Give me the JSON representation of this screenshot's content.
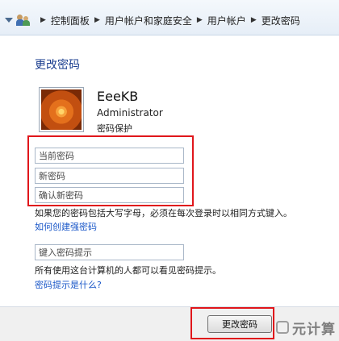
{
  "breadcrumb": {
    "items": [
      "控制面板",
      "用户帐户和家庭安全",
      "用户帐户",
      "更改密码"
    ],
    "icon": "users-icon"
  },
  "page": {
    "title": "更改密码"
  },
  "user": {
    "name": "EeeKB",
    "role": "Administrator",
    "status": "密码保护"
  },
  "form": {
    "current_password_placeholder": "当前密码",
    "new_password_placeholder": "新密码",
    "confirm_password_placeholder": "确认新密码",
    "caps_note": "如果您的密码包括大写字母，必须在每次登录时以相同方式键入。",
    "strong_password_link": "如何创建强密码",
    "hint_placeholder": "键入密码提示",
    "hint_note": "所有使用这台计算机的人都可以看见密码提示。",
    "hint_link": "密码提示是什么?",
    "submit_label": "更改密码"
  },
  "watermark": {
    "text": "元计算"
  },
  "colors": {
    "highlight": "#e0161b",
    "link": "#1a57c8",
    "title": "#1a3d8f"
  }
}
